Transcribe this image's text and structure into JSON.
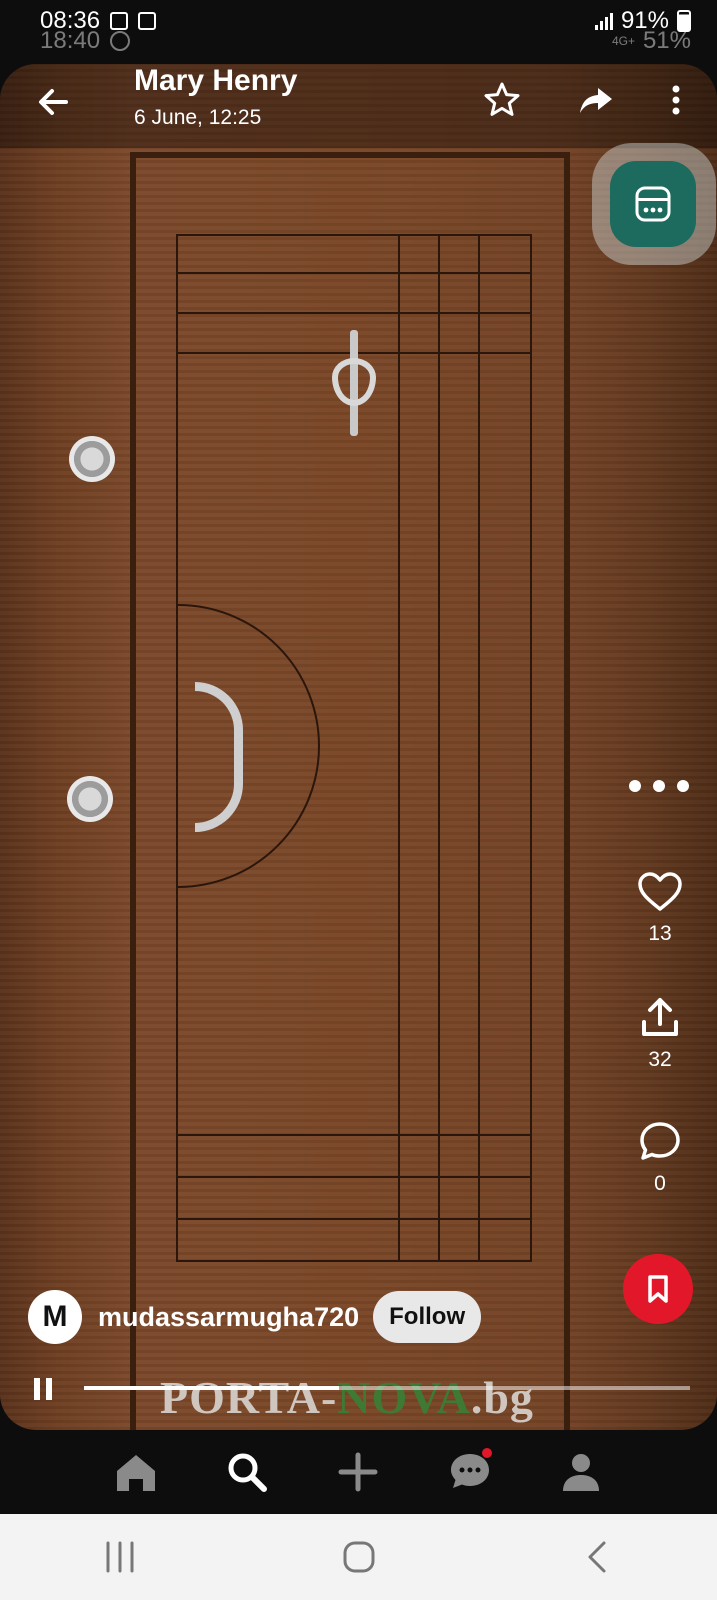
{
  "status_bar": {
    "time": "08:36",
    "battery": "91%",
    "ghost_time": "18:40",
    "ghost_battery": "51%",
    "ghost_network": "4G+"
  },
  "header": {
    "title": "Mary Henry",
    "subtitle": "6 June, 12:25",
    "icons": [
      "back-arrow-icon",
      "star-icon",
      "share-icon",
      "more-vert-icon"
    ]
  },
  "post": {
    "watermark_part1": "PORTA-",
    "watermark_part2": "NOVA",
    "watermark_part3": ".bg",
    "author_initial": "M",
    "author": "mudassarmugha720",
    "follow_label": "Follow",
    "likes": "13",
    "shares": "32",
    "comments": "0",
    "progress": 0.42
  },
  "bottom_nav": {
    "items": [
      "home-icon",
      "search-icon",
      "add-icon",
      "messages-icon",
      "profile-icon"
    ],
    "active": "search-icon"
  },
  "colors": {
    "accent_red": "#e2182a",
    "bubble_teal": "#1c6b5e",
    "wood": "#7a4727"
  }
}
